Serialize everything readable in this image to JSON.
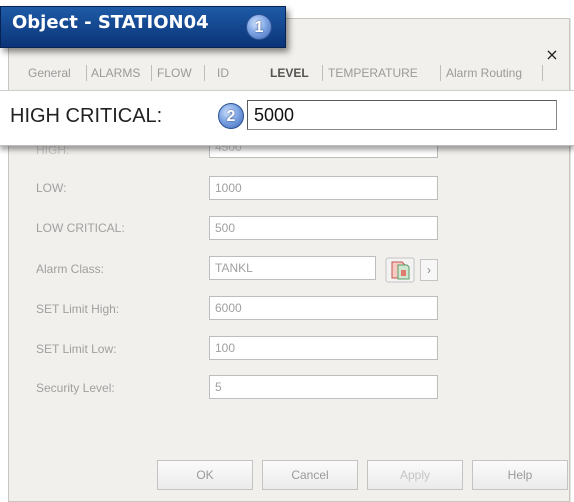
{
  "window": {
    "title": "Object - STATION04",
    "close_glyph": "×"
  },
  "callouts": {
    "badge1": "1",
    "badge2": "2"
  },
  "tabs": [
    {
      "label": "General",
      "active": false
    },
    {
      "label": "ALARMS",
      "active": false
    },
    {
      "label": "FLOW",
      "active": false
    },
    {
      "label": "ID",
      "active": false
    },
    {
      "label": "LEVEL",
      "active": true
    },
    {
      "label": "TEMPERATURE",
      "active": false
    },
    {
      "label": "Alarm Routing",
      "active": false
    }
  ],
  "high_critical": {
    "label": "HIGH CRITICAL:",
    "value": "5000"
  },
  "fields": {
    "high": {
      "label": "HIGH:",
      "value": "4500"
    },
    "low": {
      "label": "LOW:",
      "value": "1000"
    },
    "low_critical": {
      "label": "LOW CRITICAL:",
      "value": "500"
    },
    "alarm_class": {
      "label": "Alarm Class:",
      "value": "TANKL"
    },
    "set_high": {
      "label": "SET Limit High:",
      "value": "6000"
    },
    "set_low": {
      "label": "SET Limit Low:",
      "value": "100"
    },
    "security": {
      "label": "Security Level:",
      "value": "5"
    }
  },
  "icons": {
    "alarm_class_browse": "alarm-class-icon",
    "alarm_class_arrow": "›"
  },
  "buttons": {
    "ok": "OK",
    "cancel": "Cancel",
    "apply": "Apply",
    "help": "Help"
  },
  "colors": {
    "title_bar": "#0a3478",
    "badge": "#5b86d0",
    "dialog_bg": "#f2f0ec"
  }
}
